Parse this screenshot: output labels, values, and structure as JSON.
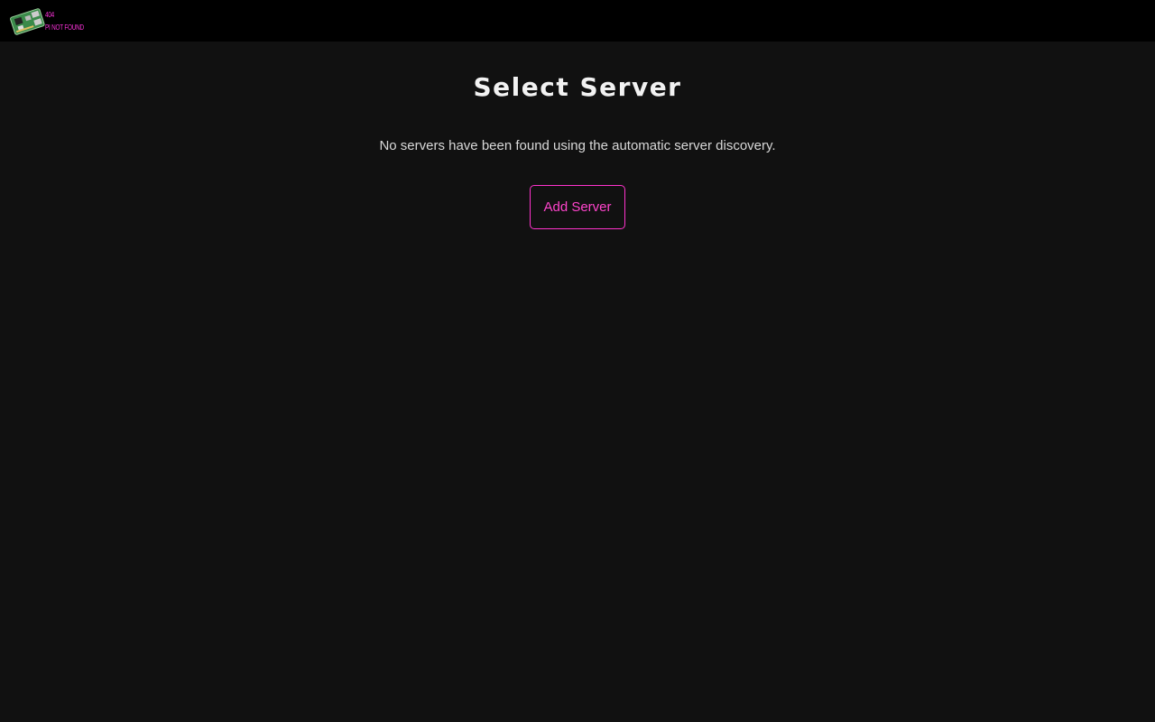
{
  "header": {
    "logo": {
      "line1": "404",
      "line2": "PI NOT FOUND"
    }
  },
  "main": {
    "title": "Select Server",
    "message": "No servers have been found using the automatic server discovery.",
    "add_server_label": "Add Server"
  },
  "colors": {
    "background": "#111111",
    "header_background": "#000000",
    "accent": "#ff33cc"
  }
}
